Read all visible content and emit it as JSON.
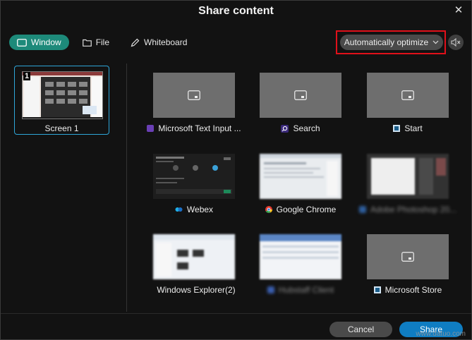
{
  "dialog": {
    "title": "Share content"
  },
  "tabs": [
    {
      "label": "Window",
      "icon": "window-icon",
      "active": true
    },
    {
      "label": "File",
      "icon": "folder-icon",
      "active": false
    },
    {
      "label": "Whiteboard",
      "icon": "pen-icon",
      "active": false
    }
  ],
  "optimize": {
    "label": "Automatically optimize"
  },
  "screen": {
    "number": "1",
    "label": "Screen 1"
  },
  "windows": [
    {
      "label": "Microsoft Text Input ...",
      "icon": "text-input-icon",
      "thumb": "placeholder"
    },
    {
      "label": "Search",
      "icon": "search-icon",
      "thumb": "placeholder"
    },
    {
      "label": "Start",
      "icon": "start-icon",
      "thumb": "placeholder"
    },
    {
      "label": "Webex",
      "icon": "webex-icon",
      "thumb": "webex"
    },
    {
      "label": "Google Chrome",
      "icon": "chrome-icon",
      "thumb": "blur"
    },
    {
      "label": "Adobe Photoshop 20...",
      "icon": "photoshop-icon",
      "thumb": "blur-dark"
    },
    {
      "label": "Windows Explorer(2)",
      "icon": "folder-icon",
      "thumb": "blur"
    },
    {
      "label": "Hubstaff Client",
      "icon": "hubstaff-icon",
      "thumb": "blur"
    },
    {
      "label": "Microsoft Store",
      "icon": "store-icon",
      "thumb": "placeholder"
    }
  ],
  "footer": {
    "cancel_label": "Cancel",
    "share_label": "Share"
  },
  "watermark": "www.datuo.com",
  "colors": {
    "accent": "#1d8a7a",
    "primary": "#0f7dc2",
    "highlight": "#e0101a",
    "selection": "#2ea6d8"
  }
}
